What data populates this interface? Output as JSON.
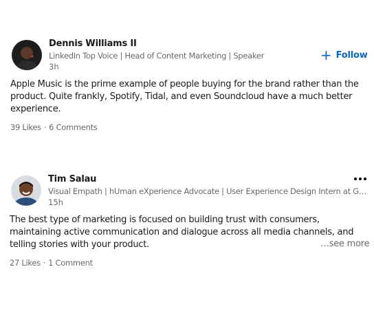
{
  "posts": [
    {
      "author": "Dennis Williams II",
      "headline": "LinkedIn Top Voice | Head of Content Marketing | Speaker",
      "time": "3h",
      "follow_label": "Follow",
      "text": "Apple Music is the prime example of people buying for the brand rather than the product. Quite frankly, Spotify, Tidal, and even Soundcloud have a much better experience.",
      "likes": "39 Likes",
      "comments": "6 Comments"
    },
    {
      "author": "Tim Salau",
      "headline": "Visual Empath | hUman eXperience Advocate | User Experience Design Intern at Goo…",
      "time": "15h",
      "text": "The best type of marketing is focused on building trust with consumers, maintaining active communication and dialogue across all media channels, and telling stories with your product.",
      "see_more": "…see more",
      "likes": "27 Likes",
      "comments": "1 Comment"
    }
  ],
  "colors": {
    "accent": "#0a66c2",
    "text_primary": "rgba(0,0,0,0.9)",
    "text_secondary": "rgba(0,0,0,0.6)"
  },
  "icons": {
    "follow": "plus-icon",
    "menu": "more-options-icon"
  }
}
